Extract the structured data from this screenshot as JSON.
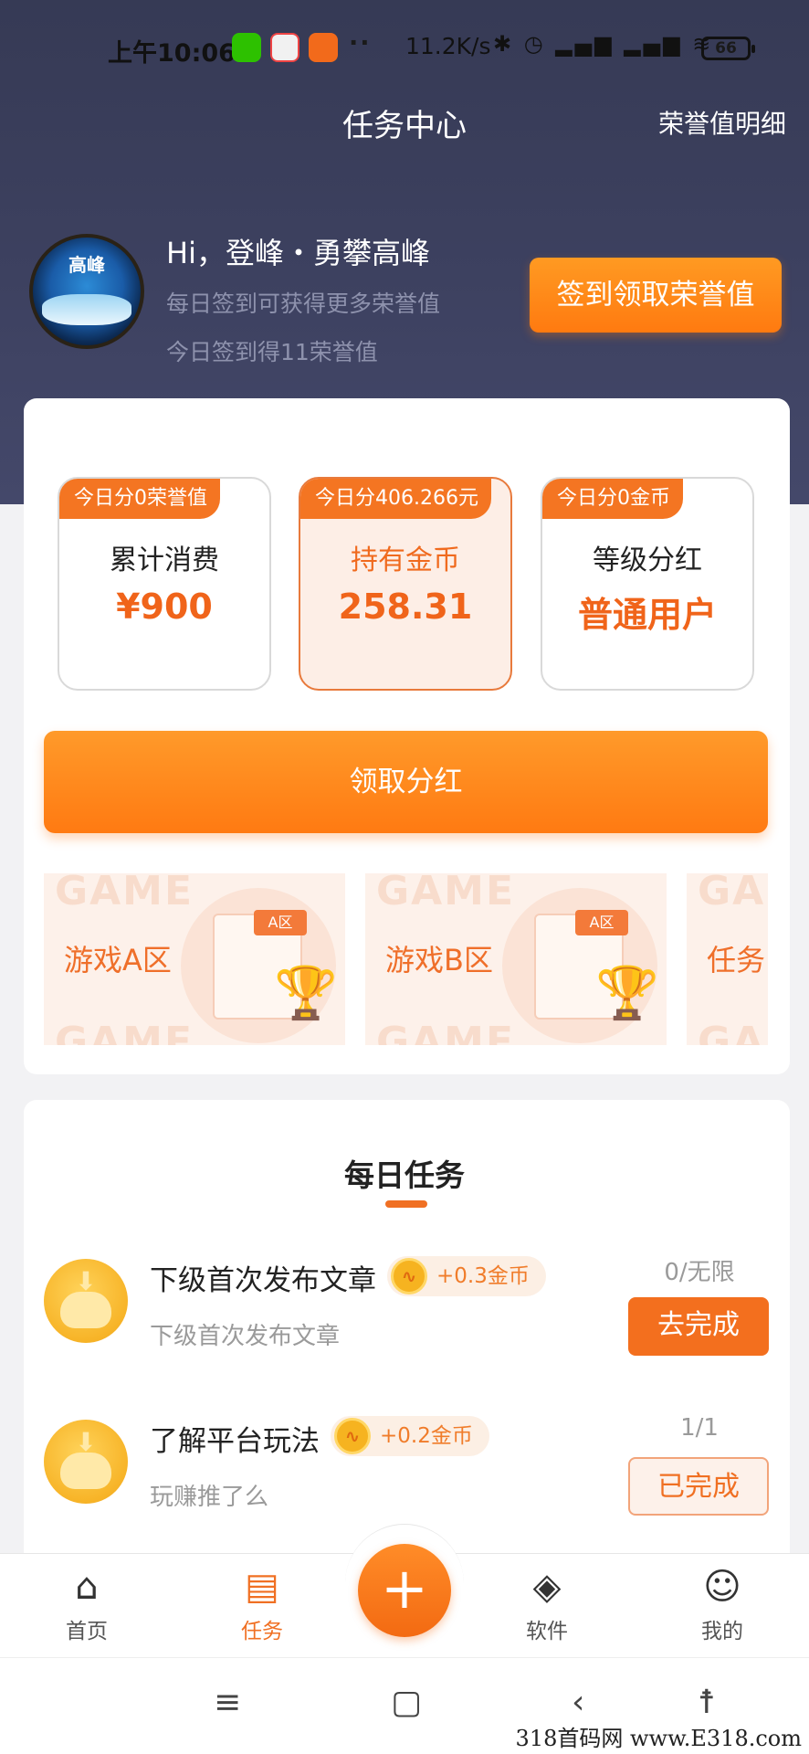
{
  "status_bar": {
    "time": "上午10:06",
    "net_speed": "11.2K/s",
    "battery": "66"
  },
  "nav": {
    "title": "任务中心",
    "right_link": "荣誉值明细"
  },
  "profile": {
    "avatar_text": "高峰",
    "greeting": "Hi，登峰・勇攀高峰",
    "line1": "每日签到可获得更多荣誉值",
    "line2": "今日签到得11荣誉值",
    "signin_button": "签到领取荣誉值"
  },
  "stats": [
    {
      "tag": "今日分0荣誉值",
      "label": "累计消费",
      "value": "¥900"
    },
    {
      "tag": "今日分406.266元",
      "label": "持有金币",
      "value": "258.31"
    },
    {
      "tag": "今日分0金币",
      "label": "等级分红",
      "value": "普通用户"
    }
  ],
  "claim_button": "领取分红",
  "zones": [
    {
      "name": "游戏A区",
      "ghost": "GAME",
      "tag": "A区"
    },
    {
      "name": "游戏B区",
      "ghost": "GAME",
      "tag": "A区"
    },
    {
      "name": "任务",
      "ghost": "GAM",
      "tag": ""
    }
  ],
  "daily": {
    "title": "每日任务",
    "tasks": [
      {
        "title": "下级首次发布文章",
        "reward": "+0.3金币",
        "subtitle": "下级首次发布文章",
        "count": "0/无限",
        "button": "去完成"
      },
      {
        "title": "了解平台玩法",
        "reward": "+0.2金币",
        "subtitle": "玩赚推了么",
        "count": "1/1",
        "button": "已完成"
      }
    ]
  },
  "tabbar": {
    "home": "首页",
    "tasks": "任务",
    "software": "软件",
    "mine": "我的",
    "fab": "+"
  },
  "watermark": "318首码网 www.E318.com",
  "colors": {
    "accent": "#f07023",
    "header_bg": "#3b3f5e"
  }
}
